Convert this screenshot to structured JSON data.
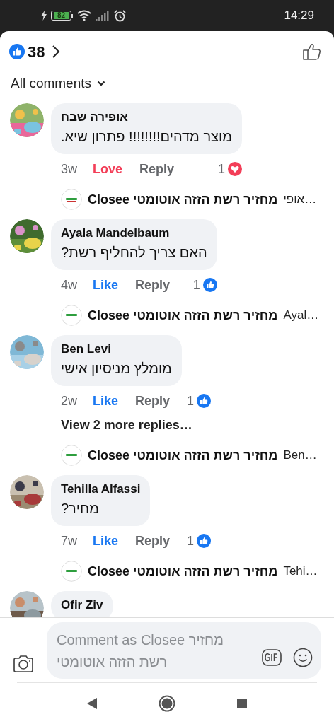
{
  "status_bar": {
    "battery": "82",
    "time": "14:29"
  },
  "reactions": {
    "count": "38"
  },
  "filter": {
    "label": "All comments"
  },
  "comments": [
    {
      "author": "אופירה שבח",
      "text": "מוצר מדהים!!!!!!!! פתרון שיא.",
      "time": "3w",
      "reaction": {
        "label": "Love",
        "kind": "love"
      },
      "reply_label": "Reply",
      "reaction_count": {
        "count": "1",
        "kind": "love"
      },
      "reply_preview": {
        "author": "Closee מחזיר רשת הזזה אוטומטי",
        "snippet": "אופי…"
      }
    },
    {
      "author": "Ayala Mandelbaum",
      "text": "האם צריך להחליף רשת?",
      "time": "4w",
      "reaction": {
        "label": "Like",
        "kind": "like"
      },
      "reply_label": "Reply",
      "reaction_count": {
        "count": "1",
        "kind": "like"
      },
      "reply_preview": {
        "author": "Closee מחזיר רשת הזזה אוטומטי",
        "snippet": "Ayal…"
      }
    },
    {
      "author": "Ben Levi",
      "text": "מומלץ מניסיון אישי",
      "time": "2w",
      "reaction": {
        "label": "Like",
        "kind": "like"
      },
      "reply_label": "Reply",
      "reaction_count": {
        "count": "1",
        "kind": "like"
      },
      "more_replies": "View 2 more replies…",
      "reply_preview": {
        "author": "Closee מחזיר רשת הזזה אוטומטי",
        "snippet": "Ben…"
      }
    },
    {
      "author": "Tehilla Alfassi",
      "text": "מחיר?",
      "time": "7w",
      "reaction": {
        "label": "Like",
        "kind": "like"
      },
      "reply_label": "Reply",
      "reaction_count": {
        "count": "1",
        "kind": "like"
      },
      "reply_preview": {
        "author": "Closee מחזיר רשת הזזה אוטומטי",
        "snippet": "Tehi…"
      }
    },
    {
      "author": "Ofir Ziv"
    }
  ],
  "composer": {
    "placeholder": "Comment as Closee מחזיר רשת הזזה אוטומטי"
  }
}
